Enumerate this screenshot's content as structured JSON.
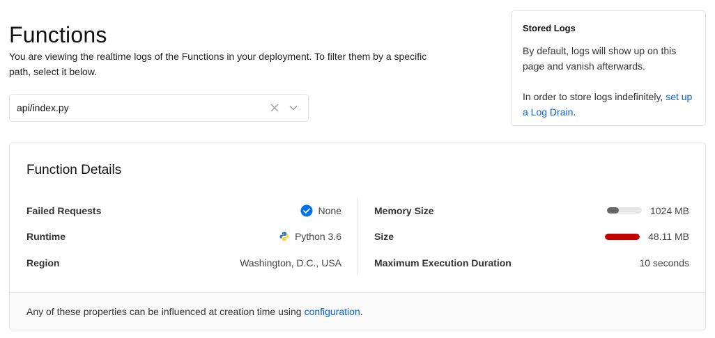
{
  "header": {
    "title": "Functions",
    "description": "You are viewing the realtime logs of the Functions in your deployment. To filter them by a specific path, select it below."
  },
  "path_select": {
    "value": "api/index.py",
    "icons": {
      "clear": "close-icon",
      "dropdown": "chevron-down-icon"
    }
  },
  "stored_logs": {
    "title": "Stored Logs",
    "text1": "By default, logs will show up on this page and vanish afterwards.",
    "text2_prefix": "In order to store logs indefinitely, ",
    "link": "set up a Log Drain",
    "text2_suffix": "."
  },
  "function_details": {
    "title": "Function Details",
    "left": [
      {
        "label": "Failed Requests",
        "value": "None",
        "icon": "check-circle-icon"
      },
      {
        "label": "Runtime",
        "value": "Python 3.6",
        "icon": "python-icon"
      },
      {
        "label": "Region",
        "value": "Washington, D.C., USA"
      }
    ],
    "right": [
      {
        "label": "Memory Size",
        "value": "1024 MB",
        "bar_fraction": 0.35
      },
      {
        "label": "Size",
        "value": "48.11 MB",
        "bar_fraction": 1.0
      },
      {
        "label": "Maximum Execution Duration",
        "value": "10 seconds"
      }
    ],
    "footer_prefix": "Any of these properties can be influenced at creation time using ",
    "footer_link": "configuration",
    "footer_suffix": "."
  },
  "colors": {
    "link": "#0761d1",
    "check": "#0070f3",
    "memory_bar": "#666666",
    "size_bar": "#c50000",
    "python_blue": "#3776ab",
    "python_yellow": "#ffd43b"
  }
}
